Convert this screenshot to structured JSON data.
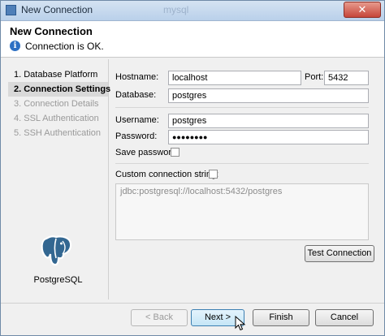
{
  "window": {
    "title": "New Connection",
    "ghost_title": "mysql",
    "close_glyph": "✕"
  },
  "header": {
    "title": "New Connection",
    "info_icon": "info-icon",
    "info_glyph": "i",
    "message": "Connection is OK."
  },
  "steps": [
    {
      "label": "1. Database Platform",
      "state": "done"
    },
    {
      "label": "2. Connection Settings",
      "state": "active"
    },
    {
      "label": "3. Connection Details",
      "state": "disabled"
    },
    {
      "label": "4. SSL Authentication",
      "state": "disabled"
    },
    {
      "label": "5. SSH Authentication",
      "state": "disabled"
    }
  ],
  "platform": {
    "name": "PostgreSQL",
    "icon": "postgresql-elephant-icon"
  },
  "form": {
    "hostname_label": "Hostname:",
    "hostname_value": "localhost",
    "port_label": "Port:",
    "port_value": "5432",
    "database_label": "Database:",
    "database_value": "postgres",
    "username_label": "Username:",
    "username_value": "postgres",
    "password_label": "Password:",
    "password_value": "●●●●●●●●",
    "save_password_label": "Save password:",
    "save_password_checked": false,
    "custom_connection_label": "Custom connection string:",
    "custom_connection_checked": false,
    "connection_string": "jdbc:postgresql://localhost:5432/postgres",
    "test_button": "Test Connection"
  },
  "footer": {
    "back_label": "< Back",
    "next_label": "Next >",
    "finish_label": "Finish",
    "cancel_label": "Cancel"
  },
  "colors": {
    "accent": "#3c7fb1",
    "info": "#2d6fc3",
    "disabled_text": "#9a9a9a"
  }
}
